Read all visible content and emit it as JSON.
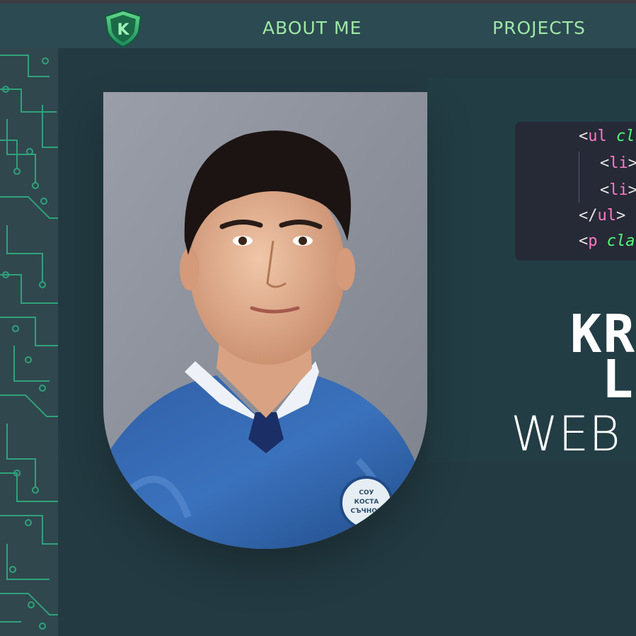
{
  "colors": {
    "background": "#233a42",
    "navbar": "#2c4a52",
    "accent": "#9de7a4",
    "circuit": "#2fa27a"
  },
  "logo": {
    "icon": "shield-k-logo",
    "letter": "K"
  },
  "nav": {
    "items": [
      {
        "label": "ABOUT ME"
      },
      {
        "label": "PROJECTS"
      }
    ]
  },
  "code": {
    "lines": [
      {
        "open": "<",
        "tag": "ul",
        "rest": " ",
        "attr": "cl"
      },
      {
        "open": "<",
        "tag": "li",
        "rest": ">",
        "attr": ""
      },
      {
        "open": "<",
        "tag": "li",
        "rest": ">",
        "attr": ""
      },
      {
        "open": "</",
        "tag": "ul",
        "rest": ">",
        "attr": ""
      },
      {
        "open": "<",
        "tag": "p",
        "rest": " ",
        "attr": "cla"
      }
    ]
  },
  "hero": {
    "name_line1": "KR",
    "name_line2": "L",
    "subtitle": "WEB"
  },
  "photo": {
    "description": "portrait-photo",
    "badge_lines": [
      "СОУ",
      "КОСТА",
      "СЪЧНОИ"
    ]
  }
}
